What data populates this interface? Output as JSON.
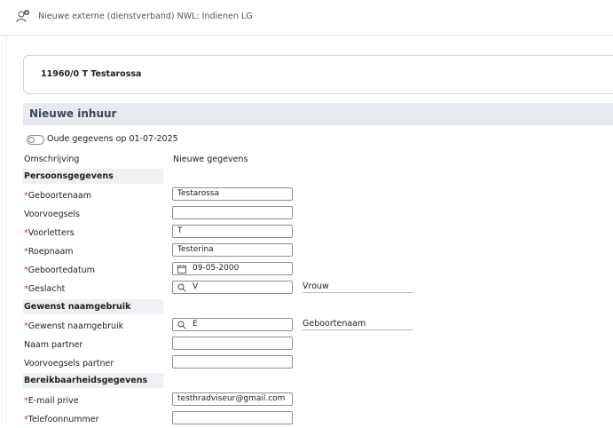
{
  "header": {
    "title": "Nieuwe externe (dienstverband) NWL: Indienen LG",
    "icon": "user-add-icon"
  },
  "employee": {
    "label": "11960/0  T Testarossa"
  },
  "section": {
    "title": "Nieuwe inhuur"
  },
  "toggle": {
    "label": "Oude gegevens op 01-07-2025",
    "on": false
  },
  "form": {
    "omschrijving_label": "Omschrijving",
    "omschrijving_value": "Nieuwe gegevens",
    "groups": {
      "persoon": "Persoonsgegevens",
      "naamgebruik": "Gewenst naamgebruik",
      "bereik": "Bereikbaarheidsgegevens"
    },
    "fields": {
      "geboortenaam": {
        "label": "Geboortenaam",
        "required": "*",
        "value": "Testarossa"
      },
      "voorvoegsels": {
        "label": "Voorvoegsels",
        "value": ""
      },
      "voorletters": {
        "label": "Voorletters",
        "required": "*",
        "value": "T"
      },
      "roepnaam": {
        "label": "Roepnaam",
        "required": "*",
        "value": "Testerina"
      },
      "geboortedatum": {
        "label": "Geboortedatum",
        "required": "*",
        "value": "09-05-2000",
        "icon": "calendar-icon"
      },
      "geslacht": {
        "label": "Geslacht",
        "required": "*",
        "value": "V",
        "icon": "search-icon",
        "description": "Vrouw"
      },
      "naamgebruik": {
        "label": "Gewenst naamgebruik",
        "required": "*",
        "value": "E",
        "icon": "search-icon",
        "description": "Geboortenaam"
      },
      "naam_partner": {
        "label": "Naam partner",
        "value": ""
      },
      "voorvoegsels_partner": {
        "label": "Voorvoegsels partner",
        "value": ""
      },
      "email": {
        "label": "E-mail prive",
        "required": "*",
        "value": "testhradviseur@gmail.com"
      },
      "telefoon": {
        "label": "Telefoonnummer",
        "required": "*",
        "value": ""
      }
    }
  },
  "colors": {
    "required": "#d62f2f",
    "section_bg": "#e7eaef",
    "group_bg": "#eef0f3"
  }
}
